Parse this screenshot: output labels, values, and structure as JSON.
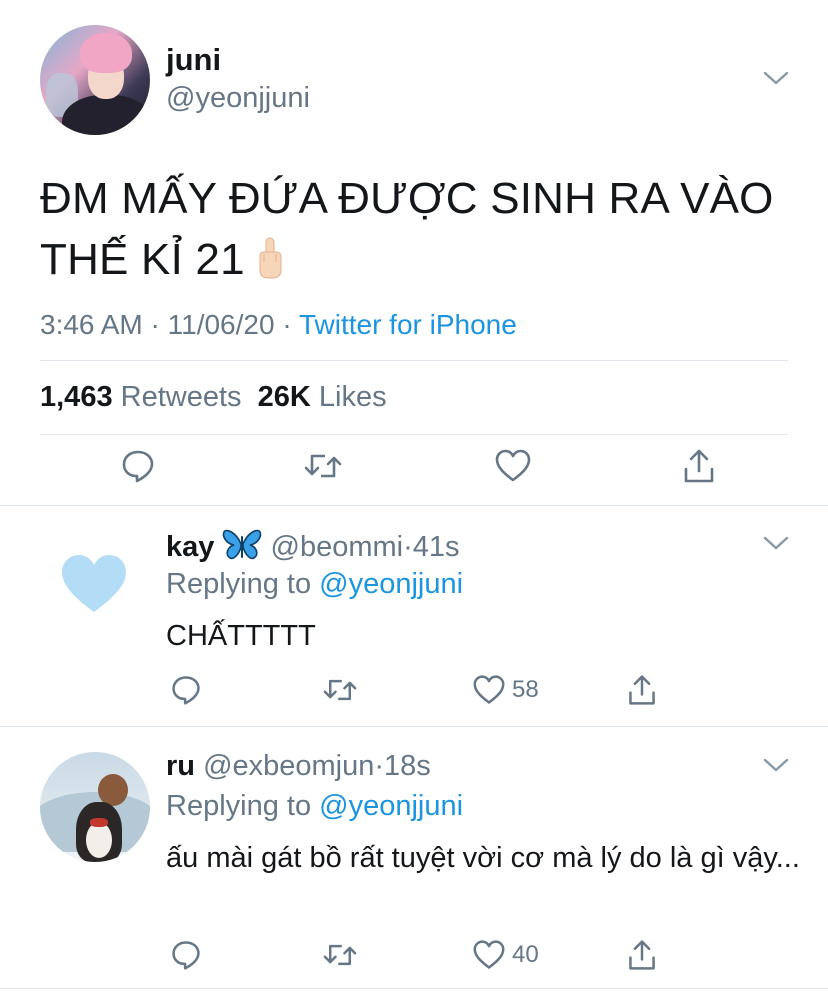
{
  "main_tweet": {
    "name": "juni",
    "handle": "@yeonjjuni",
    "text_line1": "ĐM MẤY ĐỨA ĐƯỢC SINH RA VÀO",
    "text_line2": "THẾ KỈ 21",
    "emoji": "middle-finger-emoji",
    "time": "3:46 AM",
    "date": "11/06/20",
    "separator": "·",
    "source": "Twitter for iPhone",
    "retweets_count": "1,463",
    "retweets_label": "Retweets",
    "likes_count": "26K",
    "likes_label": "Likes"
  },
  "replies": [
    {
      "name": "kay",
      "emoji": "butterfly-emoji",
      "handle": "@beommi",
      "separator": "·",
      "time": "41s",
      "replying_label": "Replying to",
      "replying_to": "@yeonjjuni",
      "text": "CHẤTTTTT",
      "likes": "58",
      "avatar": "light-blue-heart"
    },
    {
      "name": "ru",
      "handle": "@exbeomjun",
      "separator": "·",
      "time": "18s",
      "replying_label": "Replying to",
      "replying_to": "@yeonjjuni",
      "text": "ấu mài gát bồ rất tuyệt vời cơ mà lý do là gì vậy...",
      "likes": "40",
      "avatar": "penguin-photo"
    }
  ],
  "colors": {
    "text": "#14171a",
    "secondary": "#657786",
    "link": "#1b95e0",
    "divider": "#e1e8ed",
    "heart_avatar": "#b3dcf7"
  }
}
